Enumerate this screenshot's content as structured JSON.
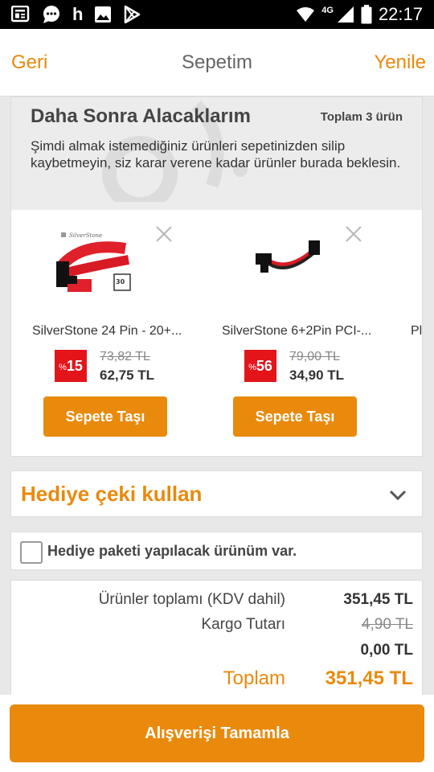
{
  "status_bar": {
    "carrier_letter": "h",
    "network": "4G",
    "time": "22:17"
  },
  "nav": {
    "back_label": "Geri",
    "title": "Sepetim",
    "refresh_label": "Yenile"
  },
  "saved_for_later": {
    "title": "Daha Sonra Alacaklarım",
    "count_label": "Toplam 3 ürün",
    "description": "Şimdi almak istemediğiniz ürünleri sepetinizden silip kaybetmeyin, siz karar verene kadar ürünler burada beklesin.",
    "products": [
      {
        "name": "SilverStone 24 Pin - 20+...",
        "discount_symbol": "%",
        "discount": "15",
        "old_price": "73,82 TL",
        "new_price": "62,75 TL",
        "button_label": "Sepete Taşı",
        "image_brand": "SilverStone",
        "image_badge": "30"
      },
      {
        "name": "SilverStone 6+2Pin PCI-...",
        "discount_symbol": "%",
        "discount": "56",
        "old_price": "79,00 TL",
        "new_price": "34,90 TL",
        "button_label": "Sepete Taşı"
      }
    ],
    "peek_product_name": "Pl"
  },
  "gift_voucher": {
    "label": "Hediye çeki kullan"
  },
  "gift_package": {
    "label": "Hediye paketi yapılacak ürünüm var.",
    "checked": false
  },
  "summary": {
    "products_total_label": "Ürünler toplamı (KDV dahil)",
    "products_total_value": "351,45 TL",
    "shipping_label": "Kargo Tutarı",
    "shipping_old_value": "4,90 TL",
    "shipping_value": "0,00 TL",
    "total_label": "Toplam",
    "total_value": "351,45 TL"
  },
  "checkout": {
    "button_label": "Alışverişi Tamamla"
  },
  "colors": {
    "accent": "#e98a0d",
    "discount_badge": "#e3151b",
    "card_image_cable": "#e0202a"
  }
}
